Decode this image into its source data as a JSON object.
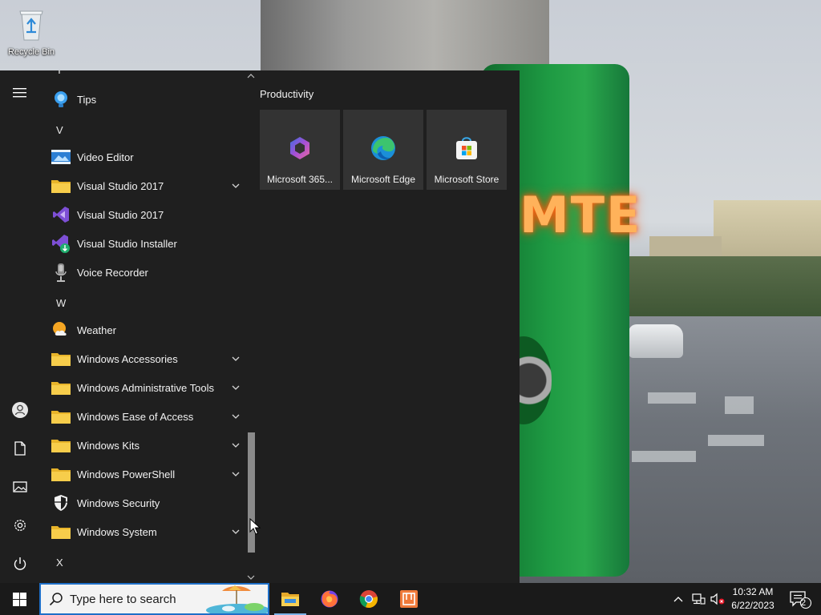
{
  "desktop": {
    "recycle_bin_label": "Recycle Bin",
    "wallpaper_sign_text": "MTE"
  },
  "start_menu": {
    "app_list": [
      {
        "kind": "letter",
        "label": "T"
      },
      {
        "kind": "app",
        "label": "Tips",
        "icon": "tips-icon"
      },
      {
        "kind": "letter",
        "label": "V"
      },
      {
        "kind": "app",
        "label": "Video Editor",
        "icon": "video-editor-icon"
      },
      {
        "kind": "folder",
        "label": "Visual Studio 2017",
        "icon": "folder-icon"
      },
      {
        "kind": "app",
        "label": "Visual Studio 2017",
        "icon": "visual-studio-icon"
      },
      {
        "kind": "app",
        "label": "Visual Studio Installer",
        "icon": "visual-studio-installer-icon"
      },
      {
        "kind": "app",
        "label": "Voice Recorder",
        "icon": "voice-recorder-icon"
      },
      {
        "kind": "letter",
        "label": "W"
      },
      {
        "kind": "app",
        "label": "Weather",
        "icon": "weather-icon"
      },
      {
        "kind": "folder",
        "label": "Windows Accessories",
        "icon": "folder-icon"
      },
      {
        "kind": "folder",
        "label": "Windows Administrative Tools",
        "icon": "folder-icon"
      },
      {
        "kind": "folder",
        "label": "Windows Ease of Access",
        "icon": "folder-icon"
      },
      {
        "kind": "folder",
        "label": "Windows Kits",
        "icon": "folder-icon"
      },
      {
        "kind": "folder",
        "label": "Windows PowerShell",
        "icon": "folder-icon"
      },
      {
        "kind": "app",
        "label": "Windows Security",
        "icon": "windows-security-icon"
      },
      {
        "kind": "folder",
        "label": "Windows System",
        "icon": "folder-icon"
      },
      {
        "kind": "letter",
        "label": "X"
      }
    ],
    "rail": [
      "hamburger-menu-icon",
      "user-account-icon",
      "documents-icon",
      "pictures-icon",
      "settings-icon",
      "power-icon"
    ],
    "tile_group": {
      "title": "Productivity",
      "tiles": [
        {
          "label": "Microsoft 365...",
          "icon": "microsoft-365-icon"
        },
        {
          "label": "Microsoft Edge",
          "icon": "microsoft-edge-icon"
        },
        {
          "label": "Microsoft Store",
          "icon": "microsoft-store-icon"
        }
      ]
    }
  },
  "taskbar": {
    "search_placeholder": "Type here to search",
    "pinned": [
      "file-explorer-icon",
      "firefox-icon",
      "chrome-icon",
      "app-icon"
    ],
    "clock_time": "10:32 AM",
    "clock_date": "6/22/2023",
    "notification_count": "2"
  },
  "colors": {
    "menu_bg": "#1f1f1f",
    "tile_bg": "#333333",
    "taskbar_bg": "#1a1a1a",
    "accent": "#1e6fc8"
  }
}
